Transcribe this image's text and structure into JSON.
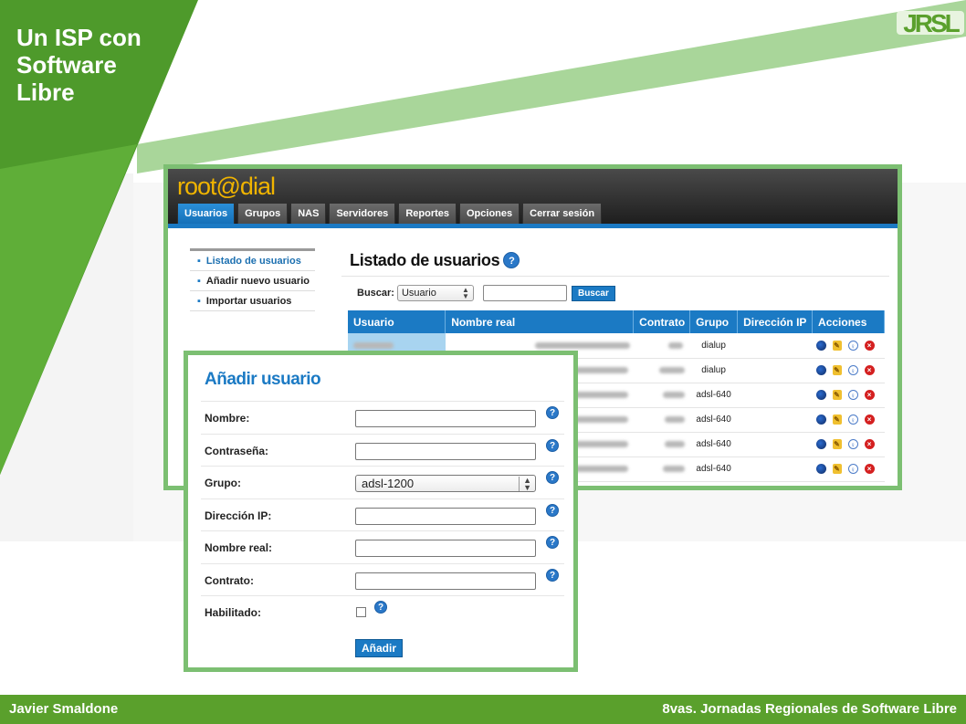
{
  "slide": {
    "title": "Un ISP con Software Libre",
    "logo": "JRSL",
    "footer_left": "Javier Smaldone",
    "footer_right": "8vas. Jornadas Regionales de Software Libre",
    "colors": {
      "dark_green": "#4e9a2b",
      "light_green": "#a9d69a",
      "frame": "#7cbf72",
      "footer": "#5aa02c",
      "app_blue": "#1b7ac4"
    }
  },
  "app": {
    "logo": "root@dial",
    "tabs": [
      "Usuarios",
      "Grupos",
      "NAS",
      "Servidores",
      "Reportes",
      "Opciones",
      "Cerrar sesión"
    ],
    "active_tab": "Usuarios",
    "sidebar": [
      "Listado de usuarios",
      "Añadir nuevo usuario",
      "Importar usuarios"
    ],
    "main_title": "Listado de usuarios",
    "search": {
      "label": "Buscar:",
      "field": "Usuario",
      "button": "Buscar"
    },
    "table": {
      "columns": [
        "Usuario",
        "Nombre real",
        "Contrato",
        "Grupo",
        "Dirección IP",
        "Acciones"
      ],
      "rows": [
        {
          "grupo": "dialup"
        },
        {
          "grupo": "dialup"
        },
        {
          "grupo": "adsl-640"
        },
        {
          "grupo": "adsl-640"
        },
        {
          "grupo": "adsl-640"
        },
        {
          "grupo": "adsl-640"
        }
      ]
    }
  },
  "form": {
    "title": "Añadir usuario",
    "fields": {
      "nombre": "Nombre:",
      "contrasena": "Contraseña:",
      "grupo": "Grupo:",
      "direccion_ip": "Dirección IP:",
      "nombre_real": "Nombre real:",
      "contrato": "Contrato:",
      "habilitado": "Habilitado:"
    },
    "grupo_value": "adsl-1200",
    "submit": "Añadir"
  },
  "icons": {
    "help": "?",
    "select_arrows": "▲▼",
    "row_actions": [
      "user-icon",
      "edit-icon",
      "lightbulb-icon",
      "delete-icon"
    ]
  }
}
